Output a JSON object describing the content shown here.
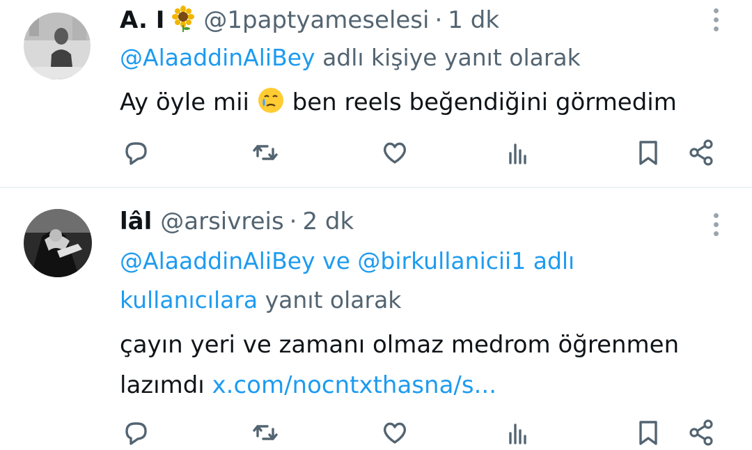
{
  "tweets": [
    {
      "name": "A. I",
      "name_emoji": "sunflower",
      "handle": "@1paptyameselesi",
      "separator": "·",
      "time": "1 dk",
      "reply_mention_1": "@AlaaddinAliBey",
      "reply_suffix": "adlı kişiye yanıt olarak",
      "text_part_1": "Ay öyle mii",
      "text_emoji": "face-holding-back-tears",
      "text_part_2": "ben reels beğendiğini görmedim"
    },
    {
      "name": "lâl",
      "handle": "@arsivreis",
      "separator": "·",
      "time": "2 dk",
      "reply_mention_1": "@AlaaddinAliBey",
      "reply_joiner": "ve",
      "reply_mention_2": "@birkullanicii1",
      "reply_mention_2_tail": "adlı",
      "reply_mention_2_line2": "kullanıcılara",
      "reply_suffix": "yanıt olarak",
      "text_line_1": "çayın yeri ve zamanı olmaz medrom öğrenmen",
      "text_line_2": "lazımdı",
      "link": "x.com/nocntxthasna/s..."
    }
  ],
  "icons": {
    "reply": "reply-icon",
    "retweet": "retweet-icon",
    "like": "like-icon",
    "views": "views-icon",
    "bookmark": "bookmark-icon",
    "share": "share-icon",
    "more": "more-icon"
  },
  "colors": {
    "text": "#0f1419",
    "muted": "#536471",
    "accent": "#1d9bf0",
    "icon": "#536471",
    "divider": "#eff3f4"
  }
}
